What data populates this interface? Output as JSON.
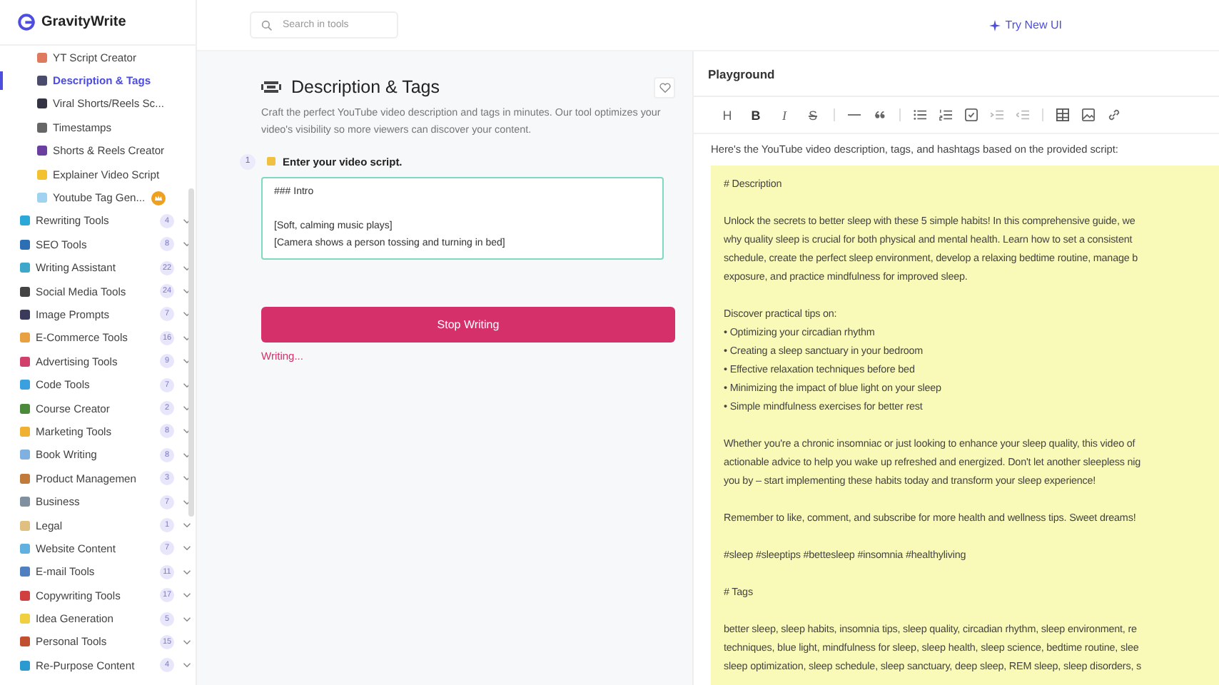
{
  "logo": {
    "name": "GravityWrite"
  },
  "sidebar": {
    "sub_items": [
      {
        "label": "YT Script Creator",
        "selected": false,
        "premium": false,
        "color": "#e07a5f"
      },
      {
        "label": "Description & Tags",
        "selected": true,
        "premium": false,
        "color": "#4b4b6b"
      },
      {
        "label": "Viral Shorts/Reels Sc...",
        "selected": false,
        "premium": false,
        "color": "#333344"
      },
      {
        "label": "Timestamps",
        "selected": false,
        "premium": false,
        "color": "#666666"
      },
      {
        "label": "Shorts & Reels Creator",
        "selected": false,
        "premium": false,
        "color": "#6b3fa0"
      },
      {
        "label": "Explainer Video Script",
        "selected": false,
        "premium": false,
        "color": "#f2c230"
      },
      {
        "label": "Youtube Tag Gen...",
        "selected": false,
        "premium": true,
        "color": "#9fd3f0"
      }
    ],
    "categories": [
      {
        "label": "Rewriting Tools",
        "count": "4",
        "color": "#2aa8d8"
      },
      {
        "label": "SEO Tools",
        "count": "8",
        "color": "#2d6fb5"
      },
      {
        "label": "Writing Assistant",
        "count": "22",
        "color": "#3fa7c9"
      },
      {
        "label": "Social Media Tools",
        "count": "24",
        "color": "#444444"
      },
      {
        "label": "Image Prompts",
        "count": "7",
        "color": "#3a3a5a"
      },
      {
        "label": "E-Commerce Tools",
        "count": "16",
        "color": "#e8a040"
      },
      {
        "label": "Advertising Tools",
        "count": "9",
        "color": "#d0406a"
      },
      {
        "label": "Code Tools",
        "count": "7",
        "color": "#3aa0e0"
      },
      {
        "label": "Course Creator",
        "count": "2",
        "color": "#4a8a3a"
      },
      {
        "label": "Marketing Tools",
        "count": "8",
        "color": "#f0b030"
      },
      {
        "label": "Book Writing",
        "count": "8",
        "color": "#7fb0e0"
      },
      {
        "label": "Product Managemen",
        "count": "3",
        "color": "#c07a3a"
      },
      {
        "label": "Business",
        "count": "7",
        "color": "#8090a0"
      },
      {
        "label": "Legal",
        "count": "1",
        "color": "#e0c080"
      },
      {
        "label": "Website Content",
        "count": "7",
        "color": "#60b0e0"
      },
      {
        "label": "E-mail Tools",
        "count": "11",
        "color": "#5080c0"
      },
      {
        "label": "Copywriting Tools",
        "count": "17",
        "color": "#d04040"
      },
      {
        "label": "Idea Generation",
        "count": "5",
        "color": "#f0d040"
      },
      {
        "label": "Personal Tools",
        "count": "15",
        "color": "#c05030"
      },
      {
        "label": "Re-Purpose Content",
        "count": "4",
        "color": "#2a9ad0"
      }
    ]
  },
  "search": {
    "placeholder": "Search in tools"
  },
  "try_new_ui": "Try New UI",
  "tool": {
    "title": "Description & Tags",
    "description": "Craft the perfect YouTube video description and tags in minutes. Our tool optimizes your video's visibility so more viewers can discover your content.",
    "step": {
      "number": "1",
      "label": "Enter your video script.",
      "value": "### Intro\n\n[Soft, calming music plays]\n[Camera shows a person tossing and turning in bed]"
    },
    "stop_button": "Stop Writing",
    "status": "Writing..."
  },
  "playground": {
    "title": "Playground",
    "toolbar": [
      {
        "kind": "heading",
        "label": "H"
      },
      {
        "kind": "bold",
        "label": "B"
      },
      {
        "kind": "italic",
        "label": "I"
      },
      {
        "kind": "strike",
        "label": "S"
      },
      {
        "kind": "separator"
      },
      {
        "kind": "rule"
      },
      {
        "kind": "quote"
      },
      {
        "kind": "separator"
      },
      {
        "kind": "bullet-list"
      },
      {
        "kind": "ordered-list"
      },
      {
        "kind": "task"
      },
      {
        "kind": "indent"
      },
      {
        "kind": "outdent"
      },
      {
        "kind": "separator"
      },
      {
        "kind": "table"
      },
      {
        "kind": "image"
      },
      {
        "kind": "link"
      }
    ],
    "intro": "Here's the YouTube video description, tags, and hashtags based on the provided script:",
    "output": [
      [
        "# Description"
      ],
      [
        "Unlock the secrets to better sleep with these 5 simple habits! In this comprehensive guide, we",
        "why quality sleep is crucial for both physical and mental health. Learn how to set a consistent",
        "schedule, create the perfect sleep environment, develop a relaxing bedtime routine, manage b",
        "exposure, and practice mindfulness for improved sleep."
      ],
      [
        "Discover practical tips on:",
        "• Optimizing your circadian rhythm",
        "• Creating a sleep sanctuary in your bedroom",
        "• Effective relaxation techniques before bed",
        "• Minimizing the impact of blue light on your sleep",
        "• Simple mindfulness exercises for better rest"
      ],
      [
        "Whether you're a chronic insomniac or just looking to enhance your sleep quality, this video of",
        "actionable advice to help you wake up refreshed and energized. Don't let another sleepless nig",
        "you by – start implementing these habits today and transform your sleep experience!"
      ],
      [
        "Remember to like, comment, and subscribe for more health and wellness tips. Sweet dreams!"
      ],
      [
        "#sleep #sleeptips #bettesleep #insomnia #healthyliving"
      ],
      [
        "# Tags"
      ],
      [
        "better sleep, sleep habits, insomnia tips, sleep quality, circadian rhythm, sleep environment, re",
        "techniques, blue light, mindfulness for sleep, sleep health, sleep science, bedtime routine, slee",
        "sleep optimization, sleep schedule, sleep sanctuary, deep sleep, REM sleep, sleep disorders, s"
      ]
    ]
  }
}
